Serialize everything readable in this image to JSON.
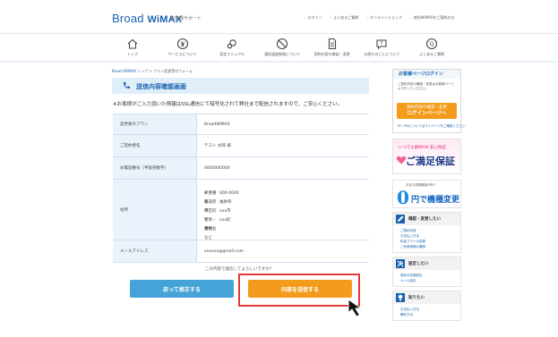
{
  "header": {
    "logo_main": "Broad",
    "logo_bold": "WiMAX",
    "logo_sub": "お客様サポート",
    "links": [
      "ログイン",
      "よくあるご質問",
      "オンラインショップ",
      "他社WiMAXをご契約の方"
    ]
  },
  "nav": [
    {
      "label": "トップ",
      "icon": "home-icon"
    },
    {
      "label": "サービスについて",
      "icon": "yen-icon"
    },
    {
      "label": "設定マニュアル",
      "icon": "gear-icon"
    },
    {
      "label": "通信速度制限について",
      "icon": "ban-icon"
    },
    {
      "label": "契約内容の確認・変更",
      "icon": "document-icon"
    },
    {
      "label": "お困りのことについて",
      "icon": "question-icon"
    },
    {
      "label": "よくあるご質問",
      "icon": "faq-icon"
    }
  ],
  "breadcrumb": {
    "home": "Broad WiMAX トップ",
    "sep": " > ",
    "current": "プラン変更受付フォーム"
  },
  "page_title": "送信内容確認画面",
  "notice": "※お客様がご入力頂いた情報はSSL通信にて暗号化されて弊社まで配信されますので、ご安心ください。",
  "form": {
    "plan_label": "変更後のプラン",
    "plan_value": "BroadWiMAX",
    "name_label": "ご契約者名",
    "name_value": "テスト 太郎 様",
    "phone_label": "お電話番号（半角英数字）",
    "phone_value": "0000000000",
    "address_label": "住所",
    "address": [
      {
        "k": "郵便番号",
        "v": "000-0000"
      },
      {
        "k": "都道府県",
        "v": "福井県"
      },
      {
        "k": "市区町村",
        "v": "xxx市"
      },
      {
        "k": "丁目・番地",
        "v": "xxx町"
      },
      {
        "k": "建物名など",
        "v": ""
      }
    ],
    "email_label": "メールアドレス",
    "email_value": "xxxxxx@gmail.com"
  },
  "confirm_question": "この内容で送信してよろしいですか？",
  "buttons": {
    "back": "戻って修正する",
    "send": "内容を送信する"
  },
  "sidebar": {
    "login_title": "お客様ページログイン",
    "login_text": "ご契約内容の確認・変更はお客様ページより行ってください。",
    "login_button_line1": "契約内容の確認・変更",
    "login_button_line2": "ログインページへ",
    "login_link": "ID・PWについてはマイページをご確認ください",
    "banner1_small": "いつでも解約OK 安心保証",
    "banner1_big": "ご満足保証",
    "banner2_small": "今なら初期費用0円!!",
    "banner2_zero": "0",
    "banner2_big": "円で機種変更",
    "sections": [
      {
        "title": "確認・変更したい",
        "icon": "edit-icon",
        "items": [
          "ご契約内容",
          "お支払い方法",
          "料金プランの変更",
          "ご利用明細の確認"
        ]
      },
      {
        "title": "設定したい",
        "icon": "tools-icon",
        "items": [
          "端末の初期設定",
          "メール設定"
        ]
      },
      {
        "title": "知りたい",
        "icon": "lightbulb-icon",
        "items": [
          "お支払い方法",
          "解約方法"
        ]
      }
    ]
  },
  "colors": {
    "brand": "#1a62b0",
    "accent_orange": "#f39c1c",
    "accent_blue": "#46a3d8",
    "highlight_red": "#e53935"
  }
}
